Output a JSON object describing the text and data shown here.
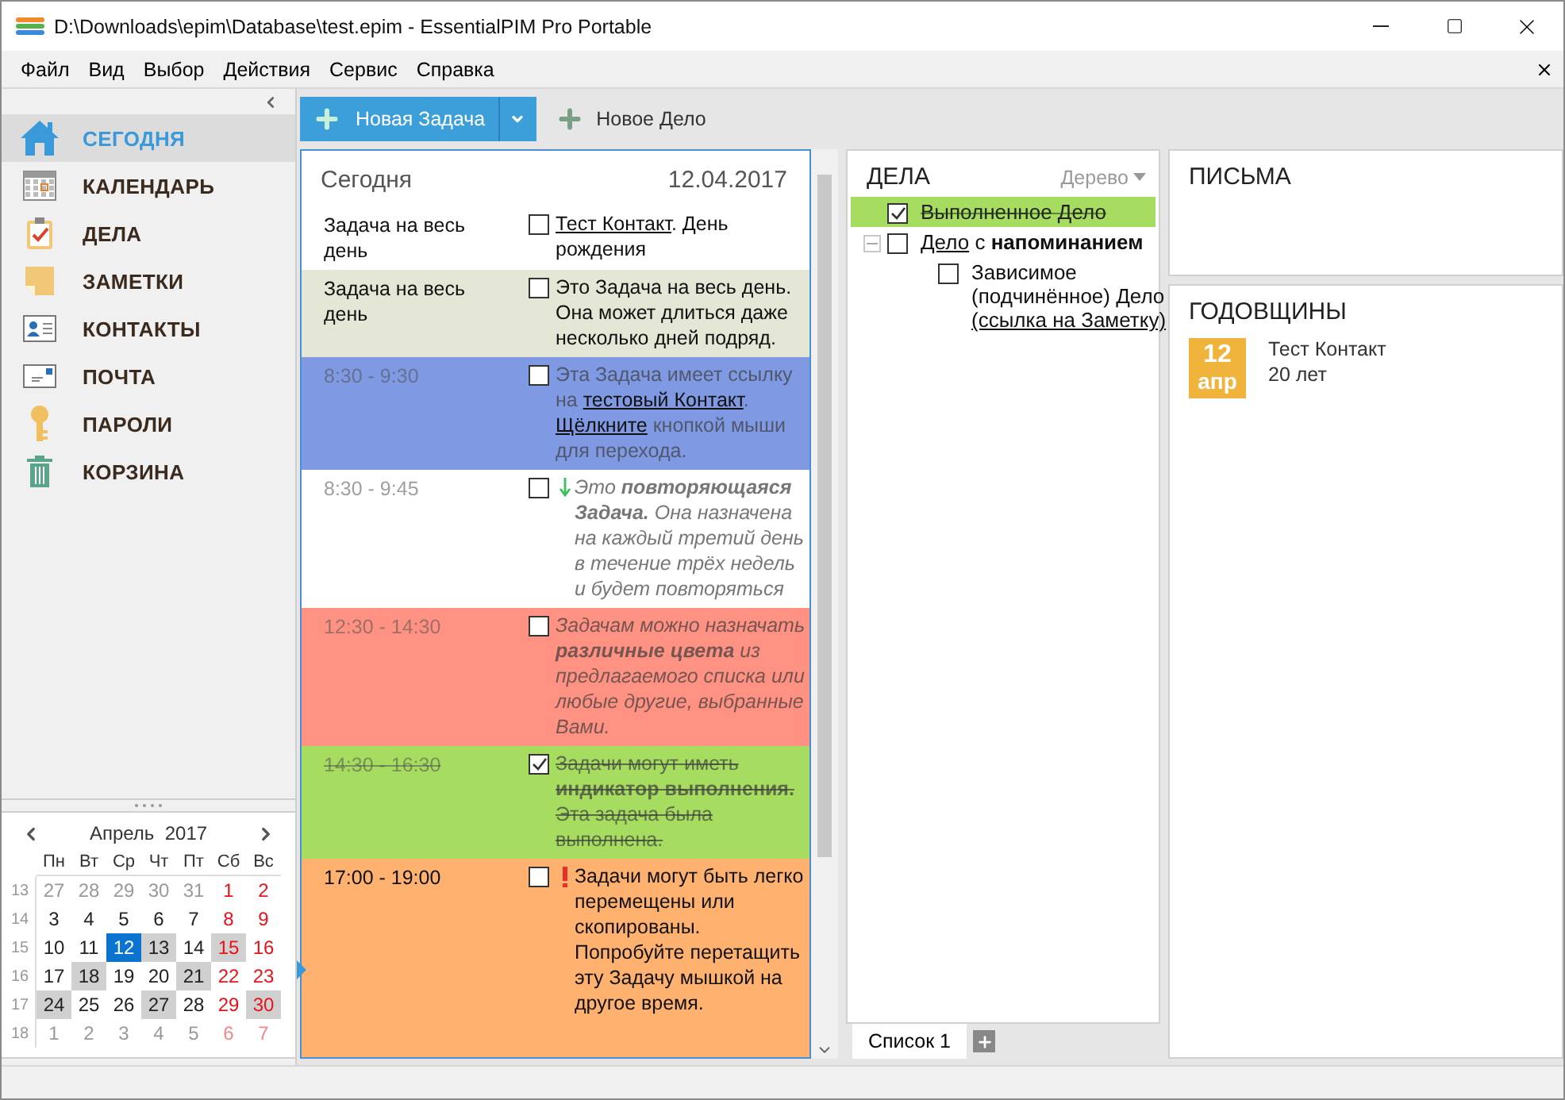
{
  "window": {
    "title": "D:\\Downloads\\epim\\Database\\test.epim - EssentialPIM Pro Portable"
  },
  "menu": [
    "Файл",
    "Вид",
    "Выбор",
    "Действия",
    "Сервис",
    "Справка"
  ],
  "sidebar": {
    "items": [
      {
        "label": "СЕГОДНЯ",
        "selected": true
      },
      {
        "label": "КАЛЕНДАРЬ",
        "selected": false
      },
      {
        "label": "ДЕЛА",
        "selected": false
      },
      {
        "label": "ЗАМЕТКИ",
        "selected": false
      },
      {
        "label": "КОНТАКТЫ",
        "selected": false
      },
      {
        "label": "ПОЧТА",
        "selected": false
      },
      {
        "label": "ПАРОЛИ",
        "selected": false
      },
      {
        "label": "КОРЗИНА",
        "selected": false
      }
    ]
  },
  "calendar": {
    "month": "Апрель",
    "year": "2017",
    "weekdays": [
      "Пн",
      "Вт",
      "Ср",
      "Чт",
      "Пт",
      "Сб",
      "Вс"
    ],
    "weeks": [
      {
        "number": "13",
        "days": [
          {
            "d": "27",
            "other": true,
            "marked": false,
            "selected": false
          },
          {
            "d": "28",
            "other": true,
            "marked": false,
            "selected": false
          },
          {
            "d": "29",
            "other": true,
            "marked": false,
            "selected": false
          },
          {
            "d": "30",
            "other": true,
            "marked": false,
            "selected": false
          },
          {
            "d": "31",
            "other": true,
            "marked": false,
            "selected": false
          },
          {
            "d": "1",
            "other": false,
            "marked": false,
            "selected": false
          },
          {
            "d": "2",
            "other": false,
            "marked": false,
            "selected": false
          }
        ]
      },
      {
        "number": "14",
        "days": [
          {
            "d": "3",
            "other": false,
            "marked": false,
            "selected": false
          },
          {
            "d": "4",
            "other": false,
            "marked": false,
            "selected": false
          },
          {
            "d": "5",
            "other": false,
            "marked": false,
            "selected": false
          },
          {
            "d": "6",
            "other": false,
            "marked": false,
            "selected": false
          },
          {
            "d": "7",
            "other": false,
            "marked": false,
            "selected": false
          },
          {
            "d": "8",
            "other": false,
            "marked": false,
            "selected": false
          },
          {
            "d": "9",
            "other": false,
            "marked": false,
            "selected": false
          }
        ]
      },
      {
        "number": "15",
        "days": [
          {
            "d": "10",
            "other": false,
            "marked": false,
            "selected": false
          },
          {
            "d": "11",
            "other": false,
            "marked": false,
            "selected": false
          },
          {
            "d": "12",
            "other": false,
            "marked": false,
            "selected": true
          },
          {
            "d": "13",
            "other": false,
            "marked": true,
            "selected": false
          },
          {
            "d": "14",
            "other": false,
            "marked": false,
            "selected": false
          },
          {
            "d": "15",
            "other": false,
            "marked": true,
            "selected": false
          },
          {
            "d": "16",
            "other": false,
            "marked": false,
            "selected": false
          }
        ]
      },
      {
        "number": "16",
        "days": [
          {
            "d": "17",
            "other": false,
            "marked": false,
            "selected": false
          },
          {
            "d": "18",
            "other": false,
            "marked": true,
            "selected": false
          },
          {
            "d": "19",
            "other": false,
            "marked": false,
            "selected": false
          },
          {
            "d": "20",
            "other": false,
            "marked": false,
            "selected": false
          },
          {
            "d": "21",
            "other": false,
            "marked": true,
            "selected": false
          },
          {
            "d": "22",
            "other": false,
            "marked": false,
            "selected": false
          },
          {
            "d": "23",
            "other": false,
            "marked": false,
            "selected": false
          }
        ]
      },
      {
        "number": "17",
        "days": [
          {
            "d": "24",
            "other": false,
            "marked": true,
            "selected": false
          },
          {
            "d": "25",
            "other": false,
            "marked": false,
            "selected": false
          },
          {
            "d": "26",
            "other": false,
            "marked": false,
            "selected": false
          },
          {
            "d": "27",
            "other": false,
            "marked": true,
            "selected": false
          },
          {
            "d": "28",
            "other": false,
            "marked": false,
            "selected": false
          },
          {
            "d": "29",
            "other": false,
            "marked": false,
            "selected": false
          },
          {
            "d": "30",
            "other": false,
            "marked": true,
            "selected": false
          }
        ]
      },
      {
        "number": "18",
        "days": [
          {
            "d": "1",
            "other": true,
            "marked": false,
            "selected": false
          },
          {
            "d": "2",
            "other": true,
            "marked": false,
            "selected": false
          },
          {
            "d": "3",
            "other": true,
            "marked": false,
            "selected": false
          },
          {
            "d": "4",
            "other": true,
            "marked": false,
            "selected": false
          },
          {
            "d": "5",
            "other": true,
            "marked": false,
            "selected": false
          },
          {
            "d": "6",
            "other": true,
            "marked": false,
            "selected": false
          },
          {
            "d": "7",
            "other": true,
            "marked": false,
            "selected": false
          }
        ]
      }
    ]
  },
  "toolbar": {
    "new_task": "Новая Задача",
    "new_todo": "Новое Дело"
  },
  "today": {
    "title": "Сегодня",
    "date": "12.04.2017",
    "events": [
      {
        "time": "Задача на весь день",
        "checked": false,
        "past": false,
        "italic": false,
        "recurring": false,
        "priority": false,
        "color": "#ffffff",
        "text": [
          {
            "t": "Тест Контакт",
            "link": true
          },
          {
            "t": ". День рождения",
            "link": false
          }
        ]
      },
      {
        "time": "Задача на весь день",
        "checked": false,
        "past": false,
        "italic": false,
        "recurring": false,
        "priority": false,
        "color": "#e4e6d6",
        "text": [
          {
            "t": "Это Задача на весь день. Она может длиться даже несколько дней подряд.",
            "link": false
          }
        ]
      },
      {
        "time": "8:30 - 9:30",
        "checked": false,
        "past": true,
        "italic": false,
        "recurring": false,
        "priority": false,
        "color": "#7f99e3",
        "text": [
          {
            "t": "Эта Задача имеет ссылку на ",
            "link": false
          },
          {
            "t": "тестовый Контакт",
            "link": true
          },
          {
            "t": ". ",
            "link": false
          },
          {
            "t": "Щёлкните",
            "link": true
          },
          {
            "t": " кнопкой мыши для перехода.",
            "link": false
          }
        ]
      },
      {
        "time": "8:30 - 9:45",
        "checked": false,
        "past": true,
        "italic": true,
        "recurring": true,
        "priority": false,
        "color": "#ffffff",
        "text": [
          {
            "t": "Это **повторяющаяся Задача.** Она назначена на каждый третий день в течение трёх недель и будет повторяться",
            "link": false
          }
        ]
      },
      {
        "time": "12:30 - 14:30",
        "checked": false,
        "past": true,
        "italic": true,
        "recurring": false,
        "priority": false,
        "color": "#ff9282",
        "text": [
          {
            "t": "Задачам можно назначать **различные цвета** из предлагаемого списка или любые другие, выбранные Вами.",
            "link": false
          }
        ]
      },
      {
        "time": "14:30 - 16:30",
        "checked": true,
        "past": true,
        "italic": false,
        "recurring": false,
        "priority": false,
        "color": "#a6dd60",
        "text": [
          {
            "t": "Задачи могут иметь **индикатор выполнения.** Эта задача была выполнена.",
            "link": false
          }
        ]
      },
      {
        "time": "17:00 - 19:00",
        "checked": false,
        "past": false,
        "italic": false,
        "recurring": false,
        "priority": true,
        "color": "#ffb270",
        "text": [
          {
            "t": "Задачи могут быть легко перемещены или скопированы. Попробуйте перетащить эту Задачу мышкой на другое время.",
            "link": false
          }
        ]
      }
    ]
  },
  "todos": {
    "title": "ДЕЛА",
    "view": "Дерево",
    "items": [
      {
        "checked": true,
        "text": [
          {
            "t": "Выполненное Дело",
            "link": false
          }
        ]
      },
      {
        "checked": false,
        "expanded": true,
        "text": [
          {
            "t": "Дело",
            "link": true
          },
          {
            "t": " с **напоминанием**",
            "link": false
          }
        ],
        "children": [
          {
            "checked": false,
            "text": [
              {
                "t": "Зависимое (подчинённое) Дело ",
                "link": false
              },
              {
                "t": "(ссылка на Заметку)",
                "link": true
              }
            ]
          }
        ]
      }
    ],
    "tabs": [
      {
        "label": "Список 1",
        "selected": true
      }
    ]
  },
  "mail": {
    "title": "ПИСЬМА"
  },
  "anniversaries": {
    "title": "ГОДОВЩИНЫ",
    "items": [
      {
        "day": "12",
        "month": "апр",
        "name": "Тест Контакт",
        "age": "20 лет"
      }
    ]
  }
}
